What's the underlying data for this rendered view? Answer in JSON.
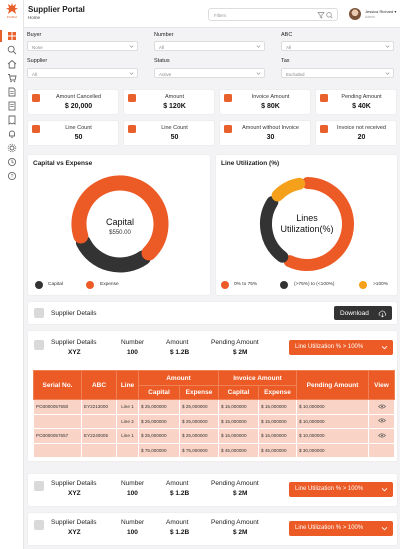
{
  "app": {
    "logo_text": "Pridhvi",
    "title": "Supplier Portal",
    "breadcrumb": "Home"
  },
  "header": {
    "filter_placeholder": "Filters",
    "user_name": "Jessica Richard",
    "user_role": "Admin"
  },
  "filters": {
    "buyer": {
      "label": "Buyer",
      "value": "None"
    },
    "number": {
      "label": "Number",
      "value": "All"
    },
    "abc": {
      "label": "ABC",
      "value": "All"
    },
    "supplier": {
      "label": "Supplier",
      "value": "All"
    },
    "status": {
      "label": "Status",
      "value": "Active"
    },
    "tax": {
      "label": "Tax",
      "value": "Excluded"
    }
  },
  "kpis": [
    {
      "label": "Amount Cancelled",
      "value": "$ 20,000"
    },
    {
      "label": "Amount",
      "value": "$ 120K"
    },
    {
      "label": "Invoice Amount",
      "value": "$ 80K"
    },
    {
      "label": "Pending Amount",
      "value": "$ 40K"
    },
    {
      "label": "Line Count",
      "value": "50"
    },
    {
      "label": "Line Count",
      "value": "50"
    },
    {
      "label": "Amount without Invoice",
      "value": "30"
    },
    {
      "label": "Invoice not received",
      "value": "20"
    }
  ],
  "capital_chart": {
    "title": "Capital vs Expense",
    "center_label": "Capital",
    "center_value": "$550.00",
    "legend": [
      "Capital",
      "Expense"
    ]
  },
  "line_chart": {
    "title": "Line Utilization (%)",
    "center_label": "Lines Utilization(%)",
    "legend": [
      "0% to 75%",
      "(>75%) to (<100%)",
      ">100%"
    ]
  },
  "chart_data": [
    {
      "type": "pie",
      "categories": [
        "Capital",
        "Expense"
      ],
      "values": [
        30,
        70
      ]
    },
    {
      "type": "pie",
      "categories": [
        "0% to 75%",
        "(>75%) to (<100%)",
        ">100%"
      ],
      "values": [
        60,
        27,
        13
      ]
    }
  ],
  "colors": {
    "accent": "#ec5a25",
    "dark": "#333333",
    "amber": "#f5a01a",
    "row_fill": "#f9d4c6"
  },
  "supplier_bar": {
    "title": "Supplier Details",
    "download": "Download"
  },
  "detail_labels": {
    "supplier": "Supplier Details",
    "number": "Number",
    "amount": "Amount",
    "pending": "Pending Amount"
  },
  "detail_rows": [
    {
      "supplier": "XYZ",
      "number": "100",
      "amount": "$ 1.2B",
      "pending": "$ 2M",
      "button": "Line Utilization % > 100%"
    },
    {
      "supplier": "XYZ",
      "number": "100",
      "amount": "$ 1.2B",
      "pending": "$ 2M",
      "button": "Line Utilization % > 100%"
    },
    {
      "supplier": "XYZ",
      "number": "100",
      "amount": "$ 1.2B",
      "pending": "$ 2M",
      "button": "Line Utilization % > 100%"
    }
  ],
  "table": {
    "headers": [
      "Serial No.",
      "ABC",
      "Line",
      "Amount",
      "Invoice Amount",
      "Pending Amount",
      "View"
    ],
    "subheaders": [
      "Capital",
      "Expense",
      "Capital",
      "Expense"
    ],
    "rows": [
      [
        "PO3000057650",
        "EY2213000",
        "Line 1",
        "$ 25,000000",
        "$ 25,000000",
        "$ 15,000000",
        "$ 15,000000",
        "$ 10,000000"
      ],
      [
        "",
        "",
        "Line 2",
        "$ 25,000000",
        "$ 25,000000",
        "$ 15,000000",
        "$ 15,000000",
        "$ 10,000000"
      ],
      [
        "PO3000057657",
        "EY2240005",
        "Line 1",
        "$ 25,000000",
        "$ 25,000000",
        "$ 15,000000",
        "$ 15,000000",
        "$ 10,000000"
      ],
      [
        "",
        "",
        "",
        "$ 75,000000",
        "$ 75,000000",
        "$ 45,000000",
        "$ 45,000000",
        "$ 30,000000"
      ]
    ]
  }
}
